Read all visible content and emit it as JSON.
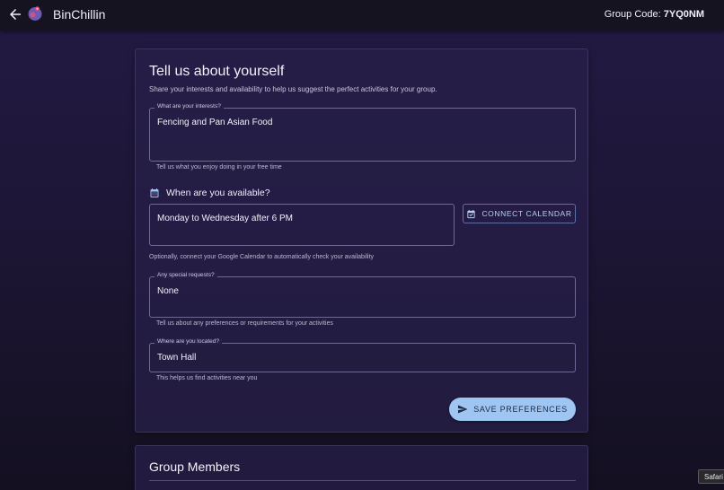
{
  "appbar": {
    "brand": "BinChillin",
    "group_code_label": "Group Code:",
    "group_code_value": "7YQ0NM"
  },
  "form": {
    "title": "Tell us about yourself",
    "subtitle": "Share your interests and availability to help us suggest the perfect activities for your group.",
    "interests": {
      "label": "What are your interests?",
      "value": "Fencing and Pan Asian Food",
      "helper": "Tell us what you enjoy doing in your free time"
    },
    "availability": {
      "section_title": "When are you available?",
      "value": "Monday to Wednesday after 6 PM",
      "connect_label": "CONNECT CALENDAR",
      "helper": "Optionally, connect your Google Calendar to automatically check your availability"
    },
    "special_requests": {
      "label": "Any special requests?",
      "value": "None",
      "helper": "Tell us about any preferences or requirements for your activities"
    },
    "location": {
      "label": "Where are you located?",
      "value": "Town Hall",
      "helper": "This helps us find activities near you"
    },
    "save_label": "SAVE PREFERENCES"
  },
  "members": {
    "title": "Group Members"
  },
  "tooltip": {
    "text": "Safari"
  },
  "icons": {
    "back": "arrow-left-icon",
    "logo": "app-logo",
    "calendar": "calendar-icon",
    "calendar_check": "calendar-check-icon",
    "send": "send-icon"
  },
  "colors": {
    "accent": "#9fc6f2",
    "outline_accent": "#b8d0f5",
    "logo_pink": "#e8457a"
  }
}
